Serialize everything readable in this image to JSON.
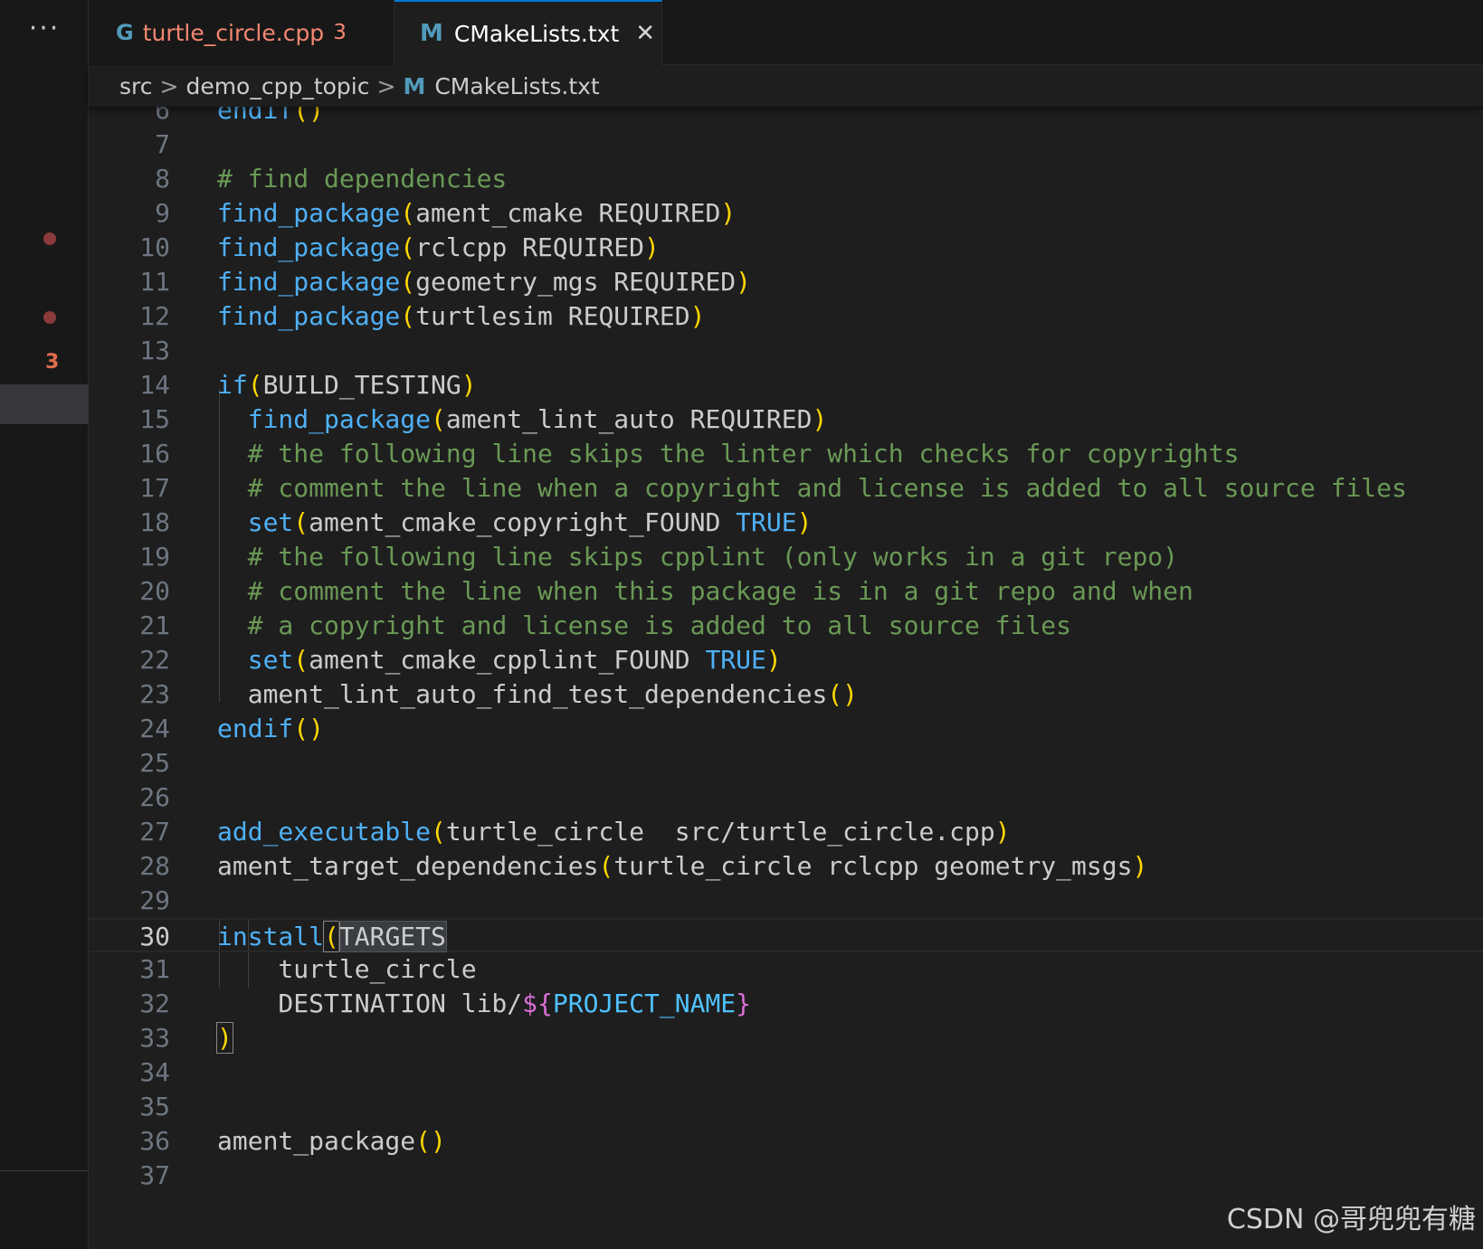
{
  "sidebar": {
    "more_label": "···",
    "problem_count": "3"
  },
  "tabs": [
    {
      "label": "turtle_circle.cpp",
      "icon": "G",
      "count": "3",
      "active": false
    },
    {
      "label": "CMakeLists.txt",
      "icon": "M",
      "active": true,
      "close": "✕"
    }
  ],
  "breadcrumb": {
    "parts": [
      "src",
      "demo_cpp_topic",
      "CMakeLists.txt"
    ],
    "file_icon": "M",
    "separator": ">"
  },
  "editor": {
    "lines": [
      {
        "n": "6",
        "tokens": [
          [
            "kw",
            "endif"
          ],
          [
            "br",
            "()"
          ]
        ]
      },
      {
        "n": "7",
        "tokens": []
      },
      {
        "n": "8",
        "tokens": [
          [
            "cm",
            "# find dependencies"
          ]
        ]
      },
      {
        "n": "9",
        "tokens": [
          [
            "fn",
            "find_package"
          ],
          [
            "br",
            "("
          ],
          [
            "pl",
            "ament_cmake REQUIRED"
          ],
          [
            "br",
            ")"
          ]
        ]
      },
      {
        "n": "10",
        "tokens": [
          [
            "fn",
            "find_package"
          ],
          [
            "br",
            "("
          ],
          [
            "pl",
            "rclcpp REQUIRED"
          ],
          [
            "br",
            ")"
          ]
        ]
      },
      {
        "n": "11",
        "tokens": [
          [
            "fn",
            "find_package"
          ],
          [
            "br",
            "("
          ],
          [
            "pl",
            "geometry_mgs REQUIRED"
          ],
          [
            "br",
            ")"
          ]
        ]
      },
      {
        "n": "12",
        "tokens": [
          [
            "fn",
            "find_package"
          ],
          [
            "br",
            "("
          ],
          [
            "pl",
            "turtlesim REQUIRED"
          ],
          [
            "br",
            ")"
          ]
        ]
      },
      {
        "n": "13",
        "tokens": []
      },
      {
        "n": "14",
        "tokens": [
          [
            "kw",
            "if"
          ],
          [
            "br",
            "("
          ],
          [
            "pl",
            "BUILD_TESTING"
          ],
          [
            "br",
            ")"
          ]
        ]
      },
      {
        "n": "15",
        "tokens": [
          [
            "pl",
            "  "
          ],
          [
            "fn",
            "find_package"
          ],
          [
            "br",
            "("
          ],
          [
            "pl",
            "ament_lint_auto REQUIRED"
          ],
          [
            "br",
            ")"
          ]
        ]
      },
      {
        "n": "16",
        "tokens": [
          [
            "pl",
            "  "
          ],
          [
            "cm",
            "# the following line skips the linter which checks for copyrights"
          ]
        ]
      },
      {
        "n": "17",
        "tokens": [
          [
            "pl",
            "  "
          ],
          [
            "cm",
            "# comment the line when a copyright and license is added to all source files"
          ]
        ]
      },
      {
        "n": "18",
        "tokens": [
          [
            "pl",
            "  "
          ],
          [
            "fn",
            "set"
          ],
          [
            "br",
            "("
          ],
          [
            "pl",
            "ament_cmake_copyright_FOUND "
          ],
          [
            "kw",
            "TRUE"
          ],
          [
            "br",
            ")"
          ]
        ]
      },
      {
        "n": "19",
        "tokens": [
          [
            "pl",
            "  "
          ],
          [
            "cm",
            "# the following line skips cpplint (only works in a git repo)"
          ]
        ]
      },
      {
        "n": "20",
        "tokens": [
          [
            "pl",
            "  "
          ],
          [
            "cm",
            "# comment the line when this package is in a git repo and when"
          ]
        ]
      },
      {
        "n": "21",
        "tokens": [
          [
            "pl",
            "  "
          ],
          [
            "cm",
            "# a copyright and license is added to all source files"
          ]
        ]
      },
      {
        "n": "22",
        "tokens": [
          [
            "pl",
            "  "
          ],
          [
            "fn",
            "set"
          ],
          [
            "br",
            "("
          ],
          [
            "pl",
            "ament_cmake_cpplint_FOUND "
          ],
          [
            "kw",
            "TRUE"
          ],
          [
            "br",
            ")"
          ]
        ]
      },
      {
        "n": "23",
        "tokens": [
          [
            "pl",
            "  ament_lint_auto_find_test_dependencies"
          ],
          [
            "br",
            "()"
          ]
        ]
      },
      {
        "n": "24",
        "tokens": [
          [
            "kw",
            "endif"
          ],
          [
            "br",
            "()"
          ]
        ]
      },
      {
        "n": "25",
        "tokens": []
      },
      {
        "n": "26",
        "tokens": []
      },
      {
        "n": "27",
        "tokens": [
          [
            "fn",
            "add_executable"
          ],
          [
            "br",
            "("
          ],
          [
            "pl",
            "turtle_circle  src/turtle_circle.cpp"
          ],
          [
            "br",
            ")"
          ]
        ]
      },
      {
        "n": "28",
        "tokens": [
          [
            "pl",
            "ament_target_dependencies"
          ],
          [
            "br",
            "("
          ],
          [
            "pl",
            "turtle_circle rclcpp geometry_msgs"
          ],
          [
            "br",
            ")"
          ]
        ]
      },
      {
        "n": "29",
        "tokens": []
      },
      {
        "n": "30",
        "tokens": [
          [
            "fn",
            "install"
          ],
          [
            "brbox",
            "("
          ],
          [
            "sel",
            "TARGETS"
          ]
        ],
        "current": true
      },
      {
        "n": "31",
        "tokens": [
          [
            "pl",
            "    turtle_circle"
          ]
        ]
      },
      {
        "n": "32",
        "tokens": [
          [
            "pl",
            "    DESTINATION lib/"
          ],
          [
            "pk",
            "${"
          ],
          [
            "vr",
            "PROJECT_NAME"
          ],
          [
            "pk",
            "}"
          ]
        ]
      },
      {
        "n": "33",
        "tokens": [
          [
            "brbox",
            ")"
          ]
        ]
      },
      {
        "n": "34",
        "tokens": []
      },
      {
        "n": "35",
        "tokens": []
      },
      {
        "n": "36",
        "tokens": [
          [
            "pl",
            "ament_package"
          ],
          [
            "br",
            "()"
          ]
        ]
      },
      {
        "n": "37",
        "tokens": []
      }
    ]
  },
  "watermark": "CSDN @哥兜兜有糖",
  "colors": {
    "keyword": "#4fb0f5",
    "bracket": "#ffd700",
    "comment": "#6a9955",
    "error": "#f48771",
    "accent": "#0078d4"
  }
}
